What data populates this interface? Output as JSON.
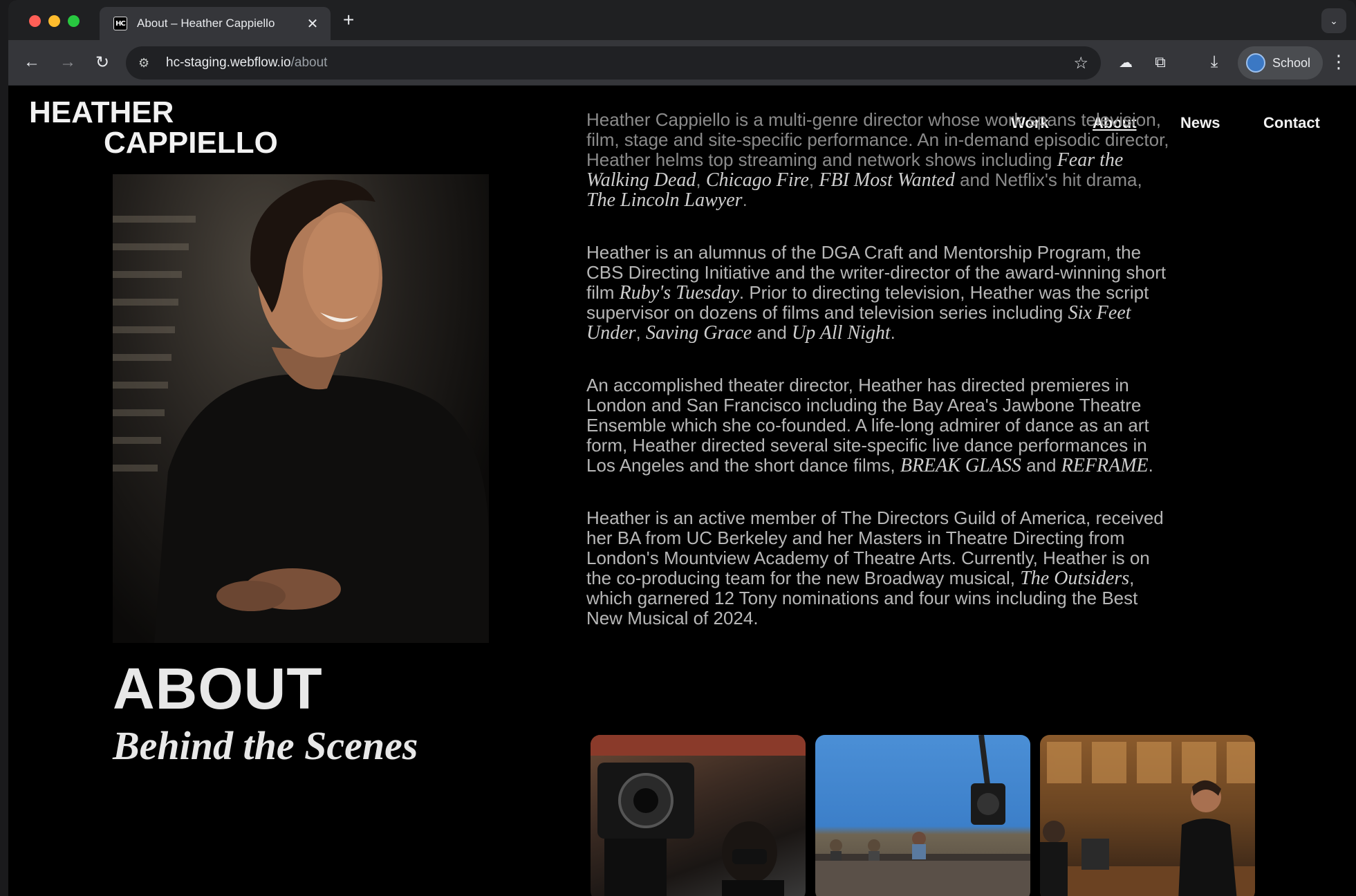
{
  "browser": {
    "tab": {
      "favicon": "HC",
      "title": "About – Heather Cappiello",
      "close": "✕"
    },
    "new_tab": "+",
    "url": {
      "host": "hc-staging.webflow.io",
      "path": "/about"
    },
    "profile_label": "School"
  },
  "site": {
    "logo": {
      "line1": "HEATHER",
      "line2": "CAPPIELLO"
    },
    "nav": [
      {
        "label": "Work",
        "active": false
      },
      {
        "label": "About",
        "active": true
      },
      {
        "label": "News",
        "active": false
      },
      {
        "label": "Contact",
        "active": false
      }
    ],
    "heading": "ABOUT",
    "subheading": "Behind the Scenes",
    "bio": {
      "p1": {
        "t1": "Heather Cappiello is a multi-genre director whose work spans television, film, stage and site-specific performance. An in-demand episodic director, Heather helms top streaming and network shows including ",
        "i1": "Fear the Walking Dead",
        "t2": ", ",
        "i2": "Chicago Fire",
        "t3": ", ",
        "i3": "FBI Most Wanted",
        "t4": " and Netflix's hit drama, ",
        "i4": "The Lincoln Lawyer",
        "t5": "."
      },
      "p2": {
        "t1": "Heather is an alumnus of the DGA Craft and Mentorship Program, the CBS Directing Initiative and the writer-director of the award-winning short film ",
        "i1": "Ruby's Tuesday",
        "t2": ". Prior to directing television, Heather was the script supervisor on dozens of films and television series including ",
        "i2": "Six Feet Under",
        "t3": ", ",
        "i3": "Saving Grace",
        "t4": " and ",
        "i4": "Up All Night",
        "t5": "."
      },
      "p3": {
        "t1": "An accomplished theater director, Heather has directed premieres in London and San Francisco including the Bay Area's Jawbone Theatre Ensemble which she co-founded. A life-long admirer of dance as an art form, Heather directed several site-specific live dance performances in Los Angeles and the short dance films, ",
        "i1": "BREAK GLASS",
        "t2": " and ",
        "i2": "REFRAME",
        "t3": "."
      },
      "p4": {
        "t1": "Heather is an active member of The Directors Guild of America, received her BA from UC Berkeley and her Masters in Theatre Directing from London's Mountview Academy of Theatre Arts. Currently, Heather is on the co-producing team for the new Broadway musical, ",
        "i1": "The Outsiders",
        "t2": ", which garnered 12 Tony nominations and four wins including the Best New Musical of 2024."
      }
    }
  }
}
